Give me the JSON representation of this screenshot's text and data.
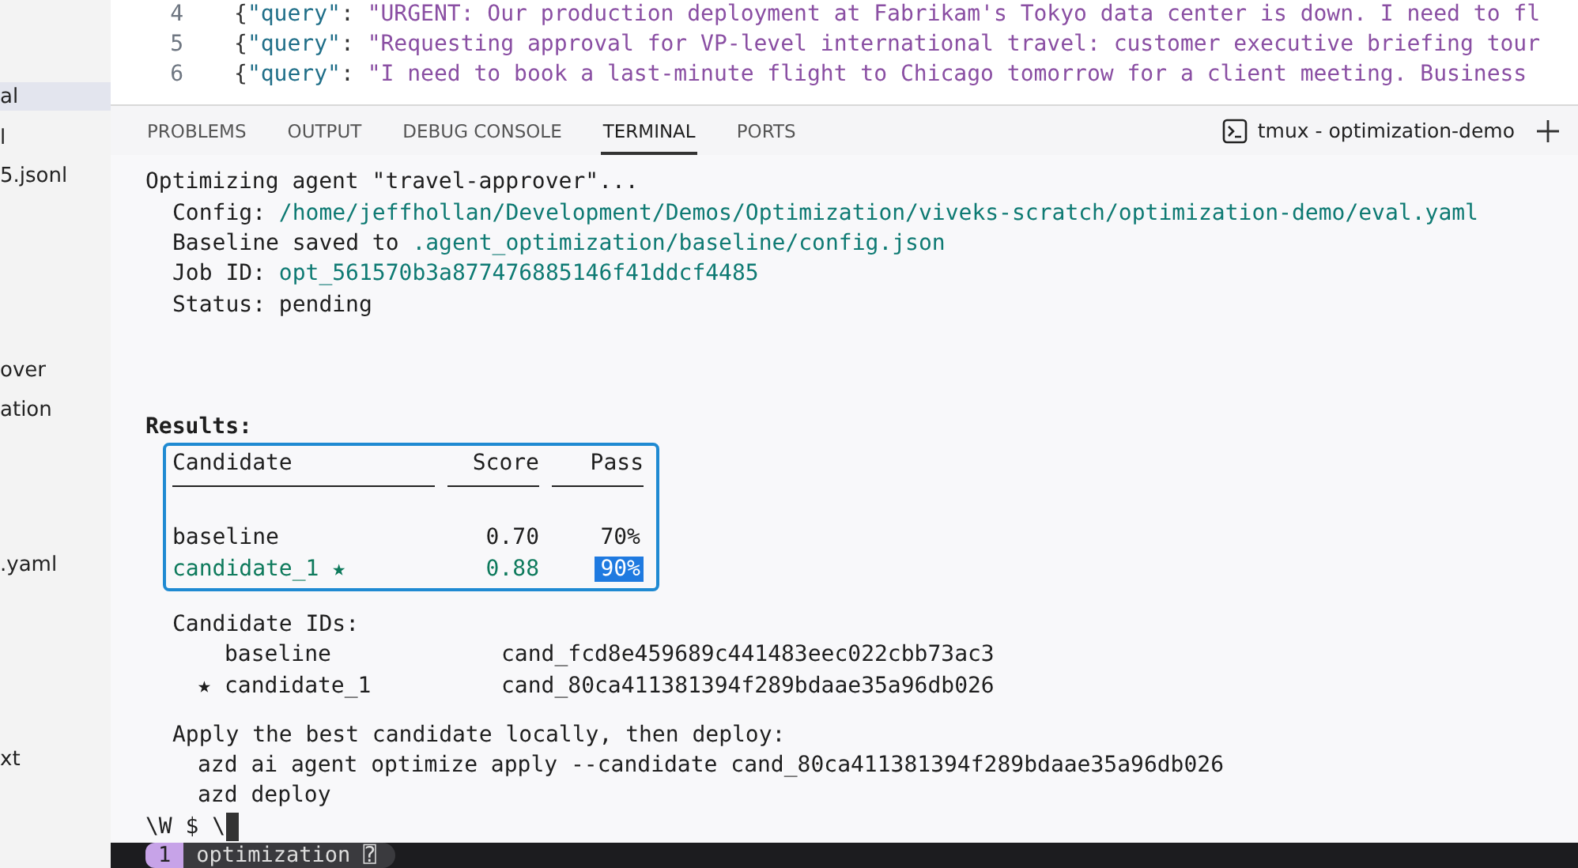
{
  "sidebar": {
    "items": [
      {
        "label": "al",
        "selected": true
      },
      {
        "label": "l",
        "selected": false
      },
      {
        "label": "5.jsonl",
        "selected": false
      },
      {
        "label": "over",
        "selected": false
      },
      {
        "label": "ation",
        "selected": false
      },
      {
        "label": ".yaml",
        "selected": false
      },
      {
        "label": "xt",
        "selected": false
      }
    ]
  },
  "editor": {
    "lines": [
      {
        "number": "4",
        "parts": [
          {
            "kind": "punct",
            "text": "{"
          },
          {
            "kind": "key",
            "text": "\"query\""
          },
          {
            "kind": "punct",
            "text": ": "
          },
          {
            "kind": "string",
            "text": "\"URGENT: Our production deployment at Fabrikam's Tokyo data center is down. I need to fl"
          }
        ]
      },
      {
        "number": "5",
        "parts": [
          {
            "kind": "punct",
            "text": "{"
          },
          {
            "kind": "key",
            "text": "\"query\""
          },
          {
            "kind": "punct",
            "text": ": "
          },
          {
            "kind": "string",
            "text": "\"Requesting approval for VP-level international travel: customer executive briefing tour"
          }
        ]
      },
      {
        "number": "6",
        "parts": [
          {
            "kind": "punct",
            "text": "{"
          },
          {
            "kind": "key",
            "text": "\"query\""
          },
          {
            "kind": "punct",
            "text": ": "
          },
          {
            "kind": "string",
            "text": "\"I need to book a last-minute flight to Chicago tomorrow for a client meeting. Business"
          }
        ]
      }
    ]
  },
  "panel": {
    "tabs": [
      {
        "label": "PROBLEMS",
        "selected": false
      },
      {
        "label": "OUTPUT",
        "selected": false
      },
      {
        "label": "DEBUG CONSOLE",
        "selected": false
      },
      {
        "label": "TERMINAL",
        "selected": true
      },
      {
        "label": "PORTS",
        "selected": false
      }
    ],
    "terminal_title": "tmux - optimization-demo"
  },
  "terminal": {
    "heading": "Optimizing agent \"travel-approver\"...",
    "fields": [
      {
        "label": "Config:",
        "value": "/home/jeffhollan/Development/Demos/Optimization/viveks-scratch/optimization-demo/eval.yaml",
        "highlight": true
      },
      {
        "label": "Baseline saved to",
        "value": ".agent_optimization/baseline/config.json",
        "highlight": true
      },
      {
        "label": "Job ID:",
        "value": "opt_561570b3a877476885146f41ddcf4485",
        "highlight": true
      },
      {
        "label": "Status:",
        "value": "pending",
        "highlight": false
      }
    ],
    "results_label": "Results:",
    "table": {
      "columns": [
        "Candidate",
        "Score",
        "Pass"
      ],
      "rows": [
        {
          "candidate": "baseline",
          "score": "0.70",
          "pass": "70%",
          "best": false
        },
        {
          "candidate": "candidate_1 ★",
          "score": "0.88",
          "pass": "90%",
          "best": true
        }
      ]
    },
    "ids_label": "Candidate IDs:",
    "ids": [
      {
        "name": "baseline",
        "id": "cand_fcd8e459689c441483eec022cbb73ac3"
      },
      {
        "marker": "★",
        "name": "candidate_1",
        "id": "cand_80ca411381394f289bdaae35a96db026"
      }
    ],
    "apply_label": "Apply the best candidate locally, then deploy:",
    "commands": [
      "azd ai agent optimize apply --candidate cand_80ca411381394f289bdaae35a96db026",
      "azd deploy"
    ],
    "prompt": "\\W $ \\"
  },
  "tmux": {
    "window_index": "1",
    "window_name": "optimization ⍰"
  }
}
